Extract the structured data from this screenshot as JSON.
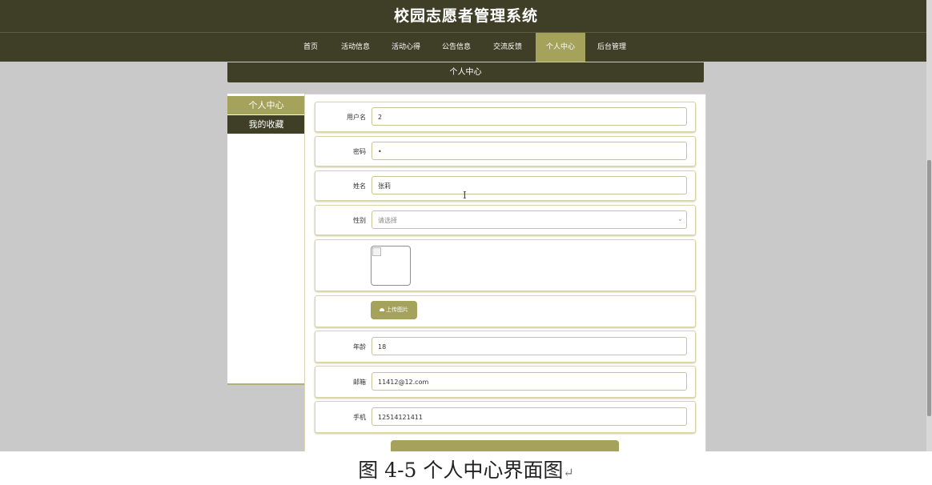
{
  "app": {
    "title": "校园志愿者管理系统"
  },
  "nav": {
    "items": [
      {
        "label": "首页"
      },
      {
        "label": "活动信息"
      },
      {
        "label": "活动心得"
      },
      {
        "label": "公告信息"
      },
      {
        "label": "交流反馈"
      },
      {
        "label": "个人中心",
        "active": true
      },
      {
        "label": "后台管理"
      }
    ]
  },
  "page": {
    "subtitle": "个人中心"
  },
  "sidebar": {
    "items": [
      {
        "label": "个人中心",
        "active": true
      },
      {
        "label": "我的收藏"
      }
    ]
  },
  "form": {
    "username": {
      "label": "用户名",
      "value": "2"
    },
    "password": {
      "label": "密码",
      "value": "•"
    },
    "name": {
      "label": "姓名",
      "value": "张莉"
    },
    "gender": {
      "label": "性别",
      "placeholder": "请选择"
    },
    "upload": {
      "label": "上传图片"
    },
    "age": {
      "label": "年龄",
      "value": "18"
    },
    "email": {
      "label": "邮箱",
      "value": "11412@12.com"
    },
    "phone": {
      "label": "手机",
      "value": "12514121411"
    }
  },
  "caption": {
    "text": "图 4-5 个人中心界面图",
    "mark": "↵"
  },
  "colors": {
    "header": "#3f3f27",
    "accent": "#a5a25b",
    "background": "#c9c9c9"
  },
  "icons": {
    "upload": "cloud-upload-icon",
    "select": "chevron-down-icon",
    "image": "broken-image-icon"
  }
}
